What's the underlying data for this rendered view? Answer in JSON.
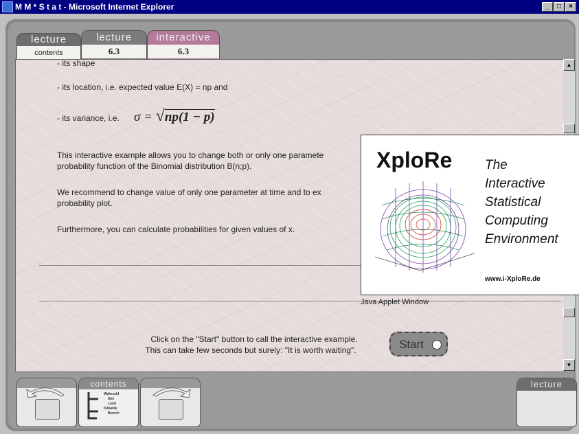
{
  "window": {
    "title": "M M * S t a t - Microsoft Internet Explorer",
    "controls": [
      "_",
      "□",
      "×"
    ]
  },
  "tabs": [
    {
      "top": "lecture",
      "bottom": "contents"
    },
    {
      "top": "lecture",
      "bottom": "6.3"
    },
    {
      "top": "interactive",
      "bottom": "6.3"
    }
  ],
  "content": {
    "lines": [
      "- its shape",
      "- its location, i.e. expected value E(X) = np and",
      "- its variance, i.e."
    ],
    "formula": "σ = √np(1 − p)",
    "formula_parts": {
      "lhs": "σ =",
      "radicand": "np(1 − p)"
    },
    "para1": [
      "This interactive example allows you to change both or only one paramete",
      "probability function of the Binomial distribution B(n;p)."
    ],
    "para2": [
      "We recommend to change value of only one parameter at time and to ex",
      "probability plot."
    ],
    "para3": "Furthermore, you can calculate probabilities for given values of x.",
    "instruction": [
      "Click on the \"Start\" button to call the interactive example.",
      "This can take few seconds but surely: \"It is worth waiting\"."
    ],
    "start_label": "Start"
  },
  "xplore": {
    "name": "XploRe",
    "tagline": [
      "The",
      "Interactive",
      "Statistical",
      "Computing",
      "Environment"
    ],
    "url": "www.i-XploRe.de",
    "applet_label": "Java Applet Window"
  },
  "bottom": {
    "contents_label": "contents",
    "tree_items": [
      "Wahrschl",
      "Sim",
      "Land",
      "Kitkalok",
      "Bumch"
    ],
    "lecture_label": "lecture"
  }
}
